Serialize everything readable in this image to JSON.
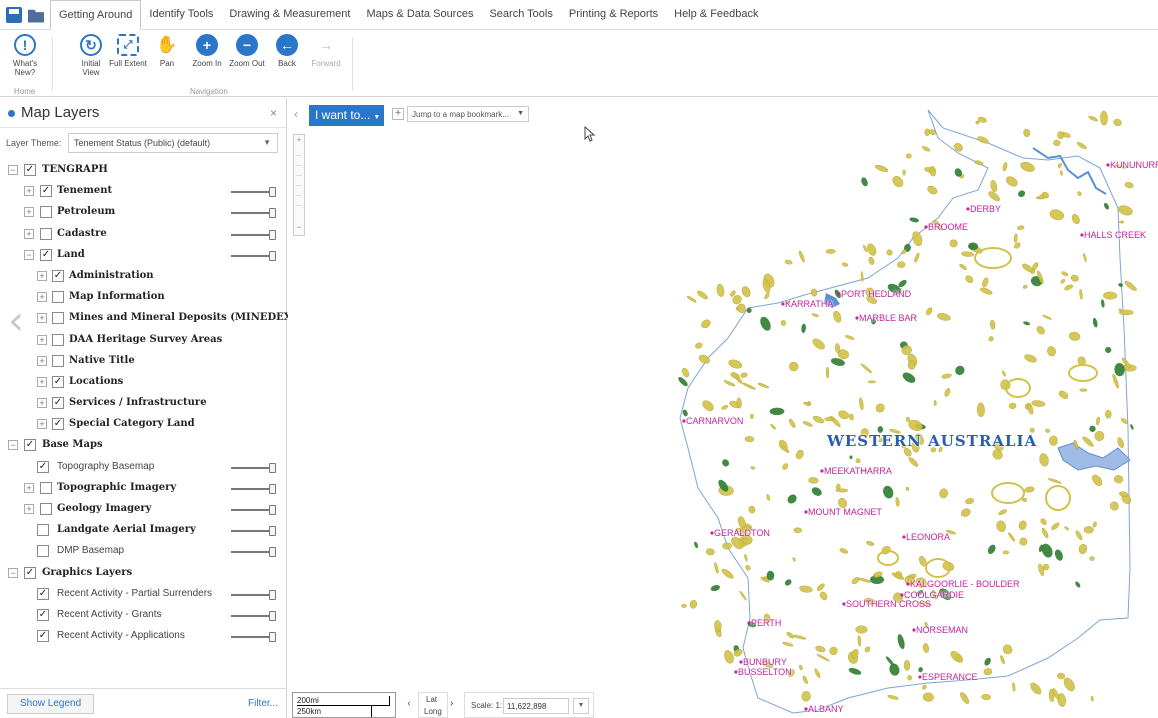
{
  "tabs": [
    "Getting Around",
    "Identify Tools",
    "Drawing & Measurement",
    "Maps & Data Sources",
    "Search Tools",
    "Printing & Reports",
    "Help & Feedback"
  ],
  "ribbon": {
    "whats_new": "What's New?",
    "initial_view": "Initial View",
    "full_extent": "Full Extent",
    "pan": "Pan",
    "zoom_in": "Zoom In",
    "zoom_out": "Zoom Out",
    "back": "Back",
    "forward": "Forward",
    "group_home": "Home",
    "group_navigation": "Navigation"
  },
  "panel": {
    "title": "Map Layers",
    "close": "×",
    "theme_label": "Layer Theme:",
    "theme_value": "Tenement Status (Public) (default)",
    "show_legend": "Show Legend",
    "filter": "Filter..."
  },
  "layers": [
    {
      "label": "TENGRAPH",
      "checked": true
    },
    {
      "label": "Tenement",
      "checked": true
    },
    {
      "label": "Petroleum",
      "checked": false
    },
    {
      "label": "Cadastre",
      "checked": false
    },
    {
      "label": "Land",
      "checked": true
    },
    {
      "label": "Administration",
      "checked": true
    },
    {
      "label": "Map Information",
      "checked": false
    },
    {
      "label": "Mines and Mineral Deposits (MINEDEX)",
      "checked": false
    },
    {
      "label": "DAA Heritage Survey Areas",
      "checked": false
    },
    {
      "label": "Native Title",
      "checked": false
    },
    {
      "label": "Locations",
      "checked": true
    },
    {
      "label": "Services / Infrastructure",
      "checked": true
    },
    {
      "label": "Special Category Land",
      "checked": true
    },
    {
      "label": "Base Maps",
      "checked": true
    },
    {
      "label": "Topography Basemap",
      "checked": true
    },
    {
      "label": "Topographic Imagery",
      "checked": false
    },
    {
      "label": "Geology Imagery",
      "checked": false
    },
    {
      "label": "Landgate Aerial Imagery",
      "checked": false
    },
    {
      "label": "DMP Basemap",
      "checked": false
    },
    {
      "label": "Graphics Layers",
      "checked": true
    },
    {
      "label": "Recent Activity - Partial Surrenders",
      "checked": true
    },
    {
      "label": "Recent Activity - Grants",
      "checked": true
    },
    {
      "label": "Recent Activity - Applications",
      "checked": true
    }
  ],
  "map": {
    "i_want_to": "I want to...",
    "bookmark_placeholder": "Jump to a map bookmark...",
    "state_label": "WESTERN AUSTRALIA",
    "towns": [
      "KUNUNURRA",
      "DERBY",
      "BROOME",
      "HALLS CREEK",
      "PORT HEDLAND",
      "KARRATHA",
      "MARBLE BAR",
      "CARNARVON",
      "MEEKATHARRA",
      "MOUNT MAGNET",
      "GERALDTON",
      "LEONORA",
      "KALGOORLIE - BOULDER",
      "COOLGARDIE",
      "SOUTHERN CROSS",
      "PERTH",
      "NORSEMAN",
      "BUNBURY",
      "BUSSELTON",
      "ESPERANCE",
      "ALBANY"
    ],
    "scale_top": "200mi",
    "scale_bottom": "250km",
    "coord_lat": "Lat",
    "coord_long": "Long",
    "scale_label": "Scale: 1:",
    "scale_value": "11,622,898"
  },
  "colors": {
    "accent": "#2a77c9",
    "town_label": "#c0249a",
    "tenement_fill": "#d2c14a",
    "tenement_green": "#2f7d32",
    "water_blue": "#5b8fd6"
  }
}
